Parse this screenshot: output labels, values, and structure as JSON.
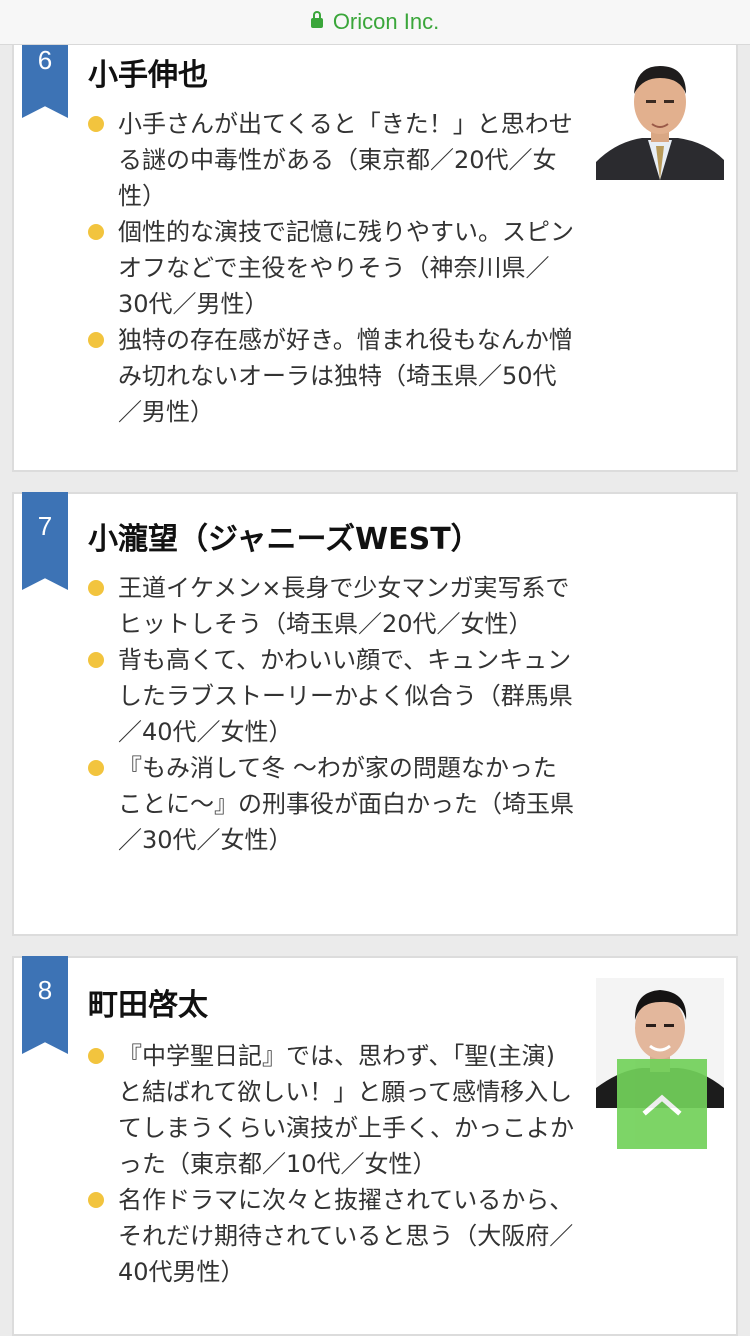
{
  "browser": {
    "domain": "Oricon Inc."
  },
  "entries": [
    {
      "rank": "6",
      "name": "小手伸也",
      "comments": [
        "小手さんが出てくると「きた！」と思わせる謎の中毒性がある（東京都／20代／女性）",
        "個性的な演技で記憶に残りやすい。スピンオフなどで主役をやりそう（神奈川県／30代／男性）",
        "独特の存在感が好き。憎まれ役もなんか憎み切れないオーラは独特（埼玉県／50代／男性）"
      ]
    },
    {
      "rank": "7",
      "name": "小瀧望（ジャニーズWEST）",
      "comments": [
        "王道イケメン×長身で少女マンガ実写系でヒットしそう（埼玉県／20代／女性）",
        "背も高くて、かわいい顔で、キュンキュンしたラブストーリーかよく似合う（群馬県／40代／女性）",
        "『もみ消して冬 〜わが家の問題なかったことに〜』の刑事役が面白かった（埼玉県／30代／女性）"
      ]
    },
    {
      "rank": "8",
      "name": "町田啓太",
      "comments": [
        "『中学聖日記』では、思わず、「聖(主演)と結ばれて欲しい！」と願って感情移入してしまうくらい演技が上手く、かっこよかった（東京都／10代／女性）",
        "名作ドラマに次々と抜擢されているから、それだけ期待されていると思う（大阪府／40代男性）"
      ]
    }
  ],
  "colors": {
    "ribbon": "#3d73b5",
    "bullet": "#f2c43e",
    "scroll_button": "#72d15a",
    "secure_green": "#3aa63a"
  }
}
